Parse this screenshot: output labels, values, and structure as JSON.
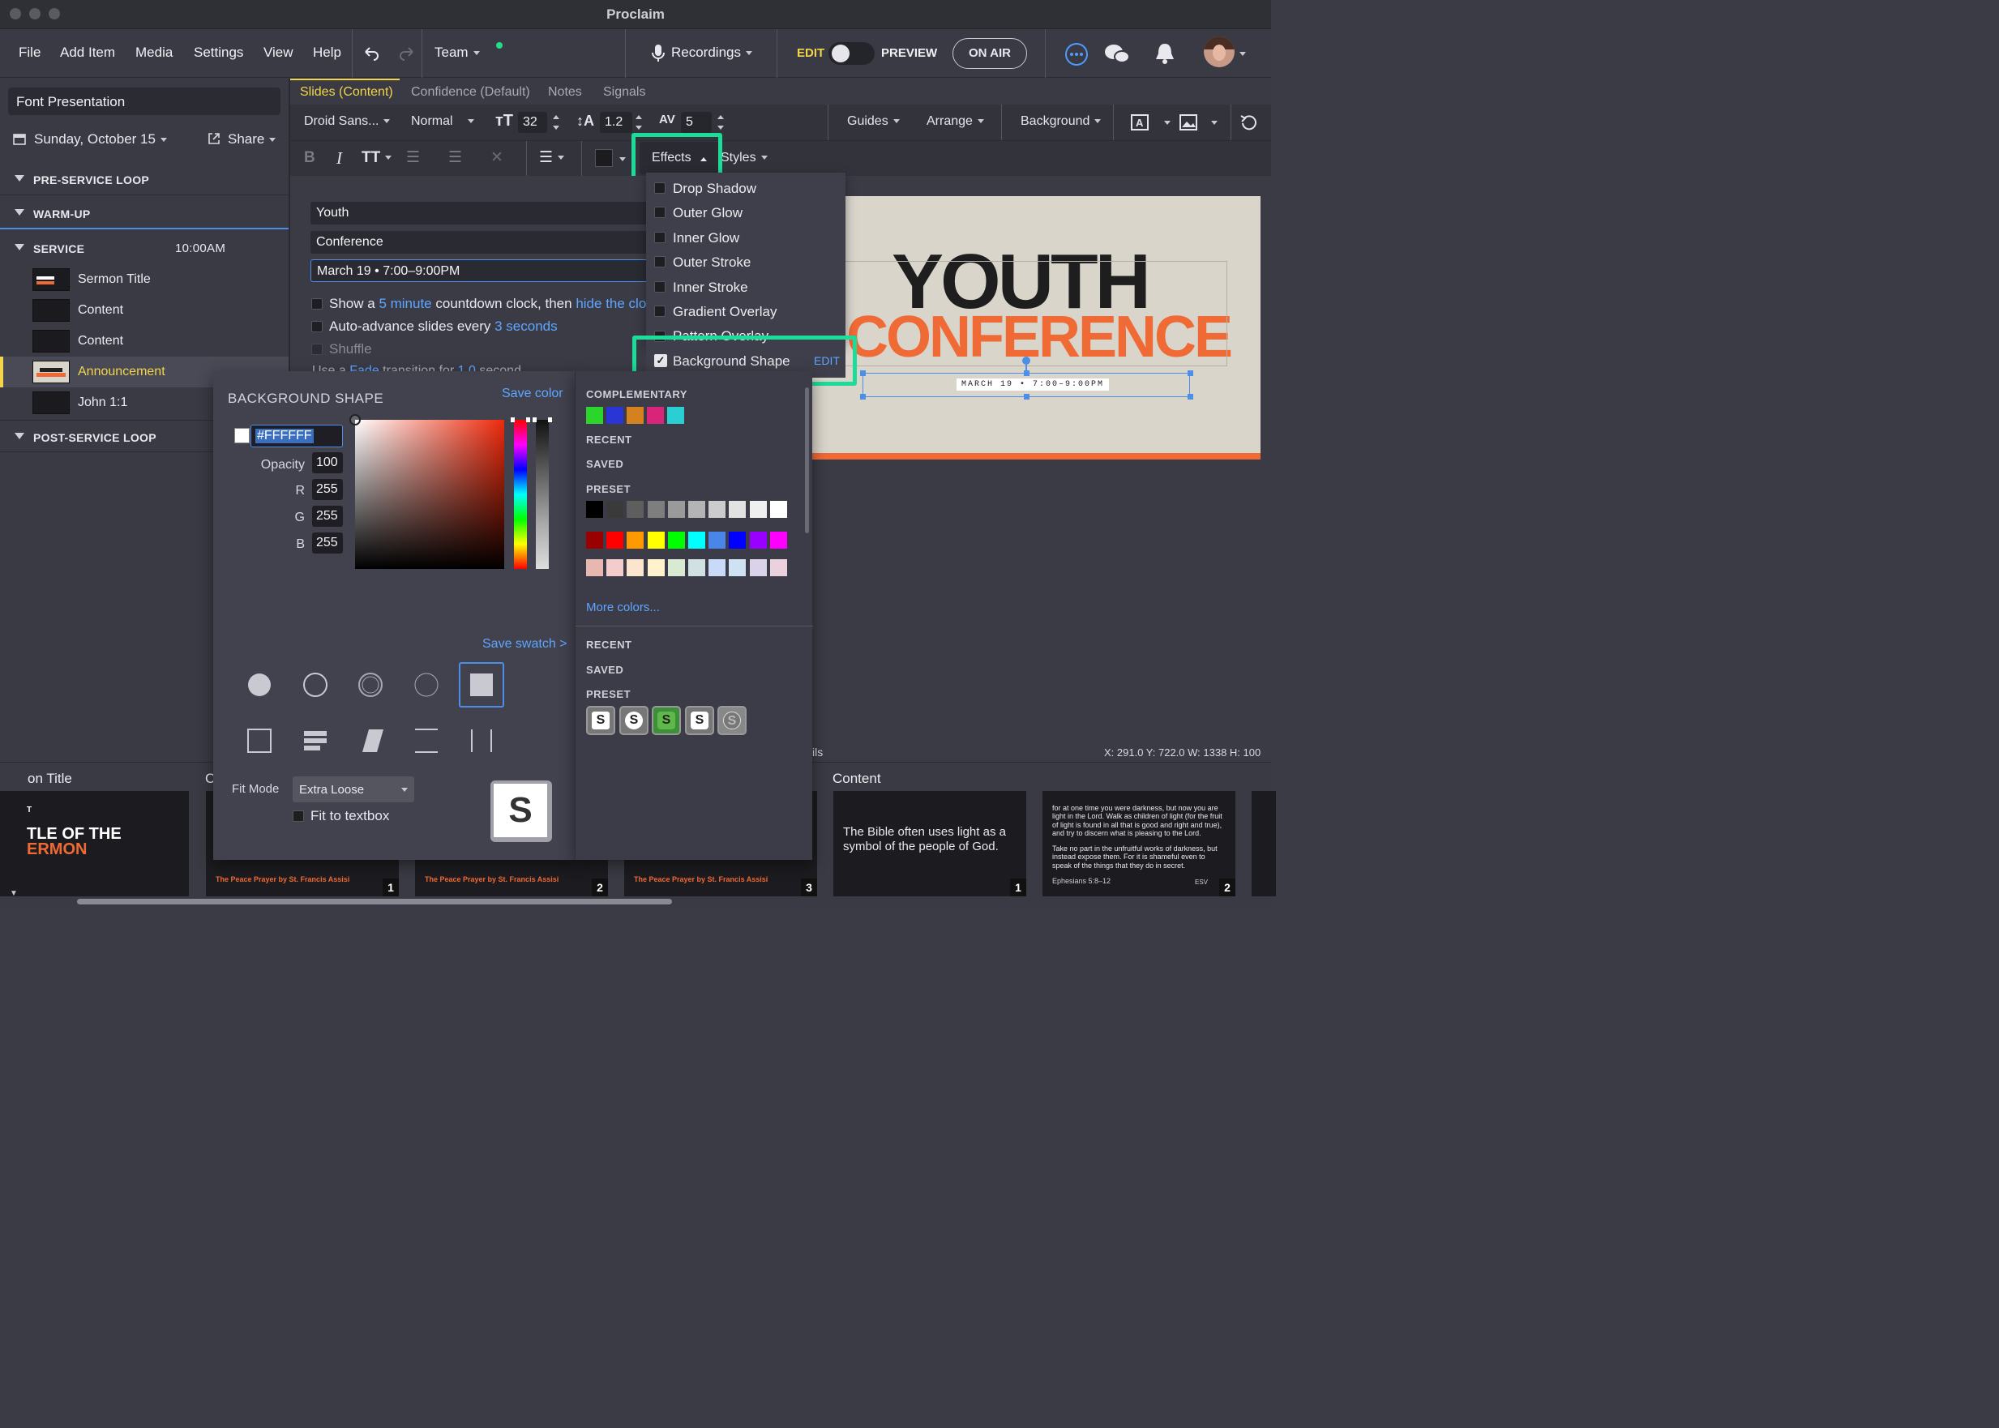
{
  "app": {
    "title": "Proclaim"
  },
  "menu": {
    "items": [
      "File",
      "Add Item",
      "Media",
      "Settings",
      "View",
      "Help"
    ],
    "team": "Team",
    "recordings": "Recordings",
    "edit": "EDIT",
    "preview": "PREVIEW",
    "on_air": "ON AIR"
  },
  "sidebar": {
    "presentation_name": "Font Presentation",
    "date": "Sunday, October 15",
    "share": "Share",
    "sections": [
      {
        "label": "PRE-SERVICE LOOP"
      },
      {
        "label": "WARM-UP"
      },
      {
        "label": "SERVICE",
        "time": "10:00AM"
      },
      {
        "label": "POST-SERVICE LOOP"
      }
    ],
    "items": [
      "Sermon Title",
      "Content",
      "Content",
      "Announcement",
      "John 1:1"
    ],
    "active_item": "Announcement"
  },
  "tabs": [
    "Slides (Content)",
    "Confidence (Default)",
    "Notes",
    "Signals"
  ],
  "toolbar": {
    "font": "Droid Sans...",
    "weight": "Normal",
    "size": "32",
    "line_height": "1.2",
    "spacing": "5",
    "guides": "Guides",
    "arrange": "Arrange",
    "background": "Background",
    "effects": "Effects",
    "styles": "Styles"
  },
  "editor": {
    "lines": [
      "Youth",
      "Conference",
      "March 19 • 7:00–9:00PM"
    ],
    "countdown_pre": "Show a",
    "countdown_link": "5 minute",
    "countdown_mid": "countdown clock, then",
    "countdown_link2": "hide the clo",
    "advance_pre": "Auto-advance slides every",
    "advance_link": "3 seconds",
    "shuffle": "Shuffle",
    "transition_pre": "Use a",
    "transition_link": "Fade",
    "transition_mid": "transition for",
    "transition_link2": "1.0",
    "transition_post": "second"
  },
  "effects_menu": {
    "items": [
      "Drop Shadow",
      "Outer Glow",
      "Inner Glow",
      "Outer Stroke",
      "Inner Stroke",
      "Gradient Overlay",
      "Pattern Overlay"
    ],
    "background_shape": "Background Shape",
    "background_shape_checked": true,
    "edit": "EDIT"
  },
  "slide": {
    "line1": "YOUTH",
    "line2": "CONFERENCE",
    "date": "MARCH 19 • 7:00–9:00PM"
  },
  "bg_shape_panel": {
    "title": "BACKGROUND SHAPE",
    "save_color": "Save color",
    "hex": "#FFFFFF",
    "opacity_label": "Opacity",
    "opacity": "100",
    "r_label": "R",
    "r": "255",
    "g_label": "G",
    "g": "255",
    "b_label": "B",
    "b": "255",
    "save_swatch": "Save swatch >",
    "fit_mode_label": "Fit Mode",
    "fit_mode": "Extra Loose",
    "fit_to_textbox": "Fit to textbox",
    "preview_glyph": "S"
  },
  "swatches": {
    "complementary_label": "COMPLEMENTARY",
    "recent_label": "RECENT",
    "saved_label": "SAVED",
    "preset_label": "PRESET",
    "more_colors": "More colors...",
    "complementary": [
      "#2bd52b",
      "#2a35d6",
      "#d4811f",
      "#d8257a",
      "#29cfd2"
    ],
    "preset_row1": [
      "#000000",
      "#3a3a3a",
      "#5e5e5e",
      "#7e7e7e",
      "#9a9a9a",
      "#b4b4b4",
      "#cccccc",
      "#e2e2e2",
      "#efefef",
      "#ffffff"
    ],
    "preset_row2": [
      "#9b0000",
      "#ff0000",
      "#ff9900",
      "#ffff00",
      "#00ff00",
      "#00ffff",
      "#4a86e8",
      "#0000ff",
      "#9900ff",
      "#ff00ff"
    ],
    "preset_row3": [
      "#e6b8af",
      "#f4cccc",
      "#fce5cd",
      "#fff2cc",
      "#d9ead3",
      "#d0e0e3",
      "#c9daf8",
      "#cfe2f3",
      "#d9d2e9",
      "#ead1dc"
    ],
    "preset_row4": [
      "#dd7e6b",
      "#ea9999",
      "#f9cb9c",
      "#ffe599",
      "#b6d7a8",
      "#a2c4c9",
      "#a4c2f4",
      "#9fc5e8",
      "#b4a7d6",
      "#d5a6bd"
    ],
    "style_glyph": "S"
  },
  "status": {
    "coords": "X: 291.0  Y: 722.0    W: 1338  H: 100",
    "partial": "ils"
  },
  "filmstrip": {
    "titles": [
      "on Title",
      "C",
      "Content"
    ],
    "thumb1_text1": "T",
    "thumb1_text2": "TLE OF THE",
    "thumb1_text3": "ERMON",
    "peace": "The Peace Prayer by St. Francis Assisi",
    "bible_text": "The Bible often uses light as a symbol of the people of God.",
    "eph_text": "for at one time you were darkness, but now you are light in the Lord. Walk as children of light (for the fruit of light is found in all that is good and right and true), and try to discern what is pleasing to the Lord.",
    "eph_text2": "Take no part in the unfruitful works of darkness, but instead expose them. For it is shameful even to speak of the things that they do in secret.",
    "eph_ref": "Ephesians 5:8–12",
    "esv": "ESV",
    "nums": [
      "1",
      "2",
      "3",
      "1",
      "2"
    ]
  }
}
